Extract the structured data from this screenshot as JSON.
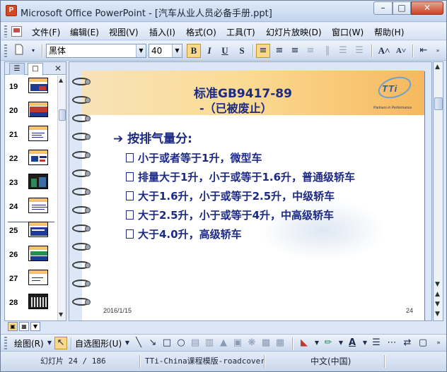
{
  "window": {
    "title": "Microsoft Office PowerPoint - [汽车从业人员必备手册.ppt]",
    "app_icon": "P",
    "min_label": "–",
    "max_label": "□",
    "close_label": "✕"
  },
  "menu": {
    "items": [
      "文件(F)",
      "编辑(E)",
      "视图(V)",
      "插入(I)",
      "格式(O)",
      "工具(T)",
      "幻灯片放映(D)",
      "窗口(W)",
      "帮助(H)"
    ]
  },
  "toolbar": {
    "font_name": "黑体",
    "font_size": "40",
    "bold": "B",
    "italic": "I",
    "underline": "U",
    "shadow": "S",
    "align_left": "≡",
    "center": "≡",
    "align_right": "≡",
    "grow_font": "A˄",
    "shrink_font": "A˅"
  },
  "panel": {
    "thumbnails": [
      {
        "number": "19"
      },
      {
        "number": "20"
      },
      {
        "number": "21"
      },
      {
        "number": "22"
      },
      {
        "number": "23"
      },
      {
        "number": "24"
      },
      {
        "number": "25"
      },
      {
        "number": "26"
      },
      {
        "number": "27"
      },
      {
        "number": "28"
      }
    ]
  },
  "slide": {
    "title": "标准GB9417-89",
    "subtitle": "-（已被废止）",
    "logo_text": "TTi",
    "logo_tagline": "Partners in Performance",
    "bullet_arrow": "➔",
    "main_bullet": "按排气量分:",
    "sub_bullets": [
      "小于或者等于1升，微型车",
      "排量大于1升，小于或等于1.6升，普通级轿车",
      "大于1.6升，小于或等于2.5升，中级轿车",
      "大于2.5升，小于或等于4升，中高级轿车",
      "大于4.0升，高级轿车"
    ],
    "date": "2016/1/15",
    "page_number": "24"
  },
  "drawbar": {
    "draw_label": "绘图(R)",
    "autoshapes_label": "自选图形(U)"
  },
  "status": {
    "slide_info": "幻灯片 24 / 186",
    "design": "TTi-China课程模版-roadcover",
    "language": "中文(中国)"
  }
}
